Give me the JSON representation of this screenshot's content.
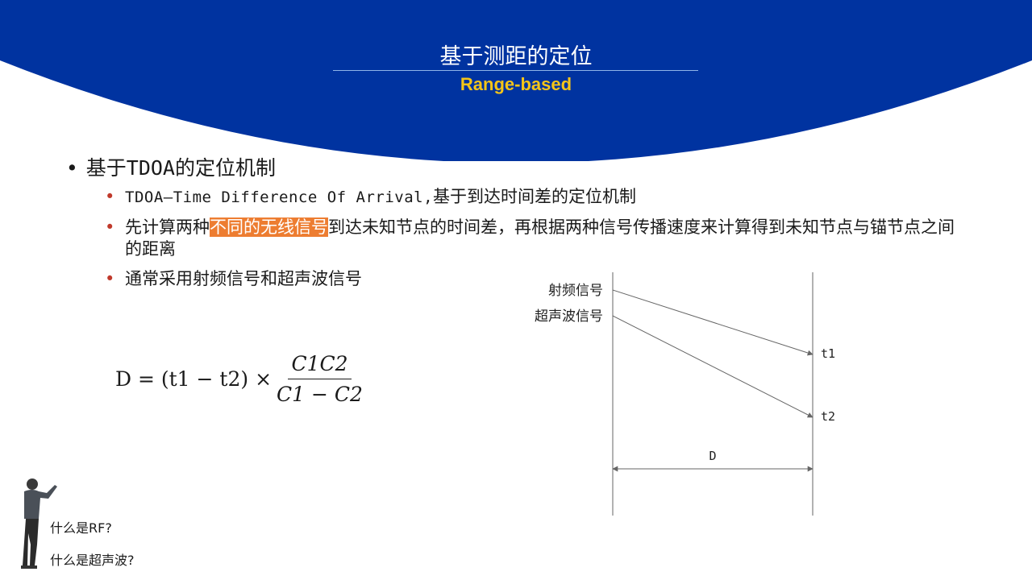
{
  "header": {
    "title": "基于测距的定位",
    "subtitle": "Range-based"
  },
  "bullet_main": {
    "prefix": "基于",
    "code": "TDOA",
    "suffix": "的定位机制"
  },
  "sub_bullets": {
    "item1": {
      "code": "TDOA–Time Difference Of Arrival,",
      "text": "基于到达时间差的定位机制"
    },
    "item2": {
      "before": "先计算两种",
      "highlight": "不同的无线信号",
      "after": "到达未知节点的时间差，再根据两种信号传播速度来计算得到未知节点与锚节点之间的距离"
    },
    "item3": {
      "text": "通常采用射频信号和超声波信号"
    }
  },
  "formula": {
    "lhs": "D = (t1 − t2) ×",
    "numerator": "C1C2",
    "denominator": "C1 − C2"
  },
  "diagram": {
    "label_rf": "射频信号",
    "label_us": "超声波信号",
    "label_t1": "t1",
    "label_t2": "t2",
    "label_d": "D"
  },
  "questions": {
    "q1": "什么是RF?",
    "q2": "什么是超声波?"
  },
  "colors": {
    "header_blue": "#0033a0",
    "subtitle_yellow": "#f5c518",
    "highlight_orange": "#ed7d31",
    "bullet_red": "#c0392b"
  }
}
